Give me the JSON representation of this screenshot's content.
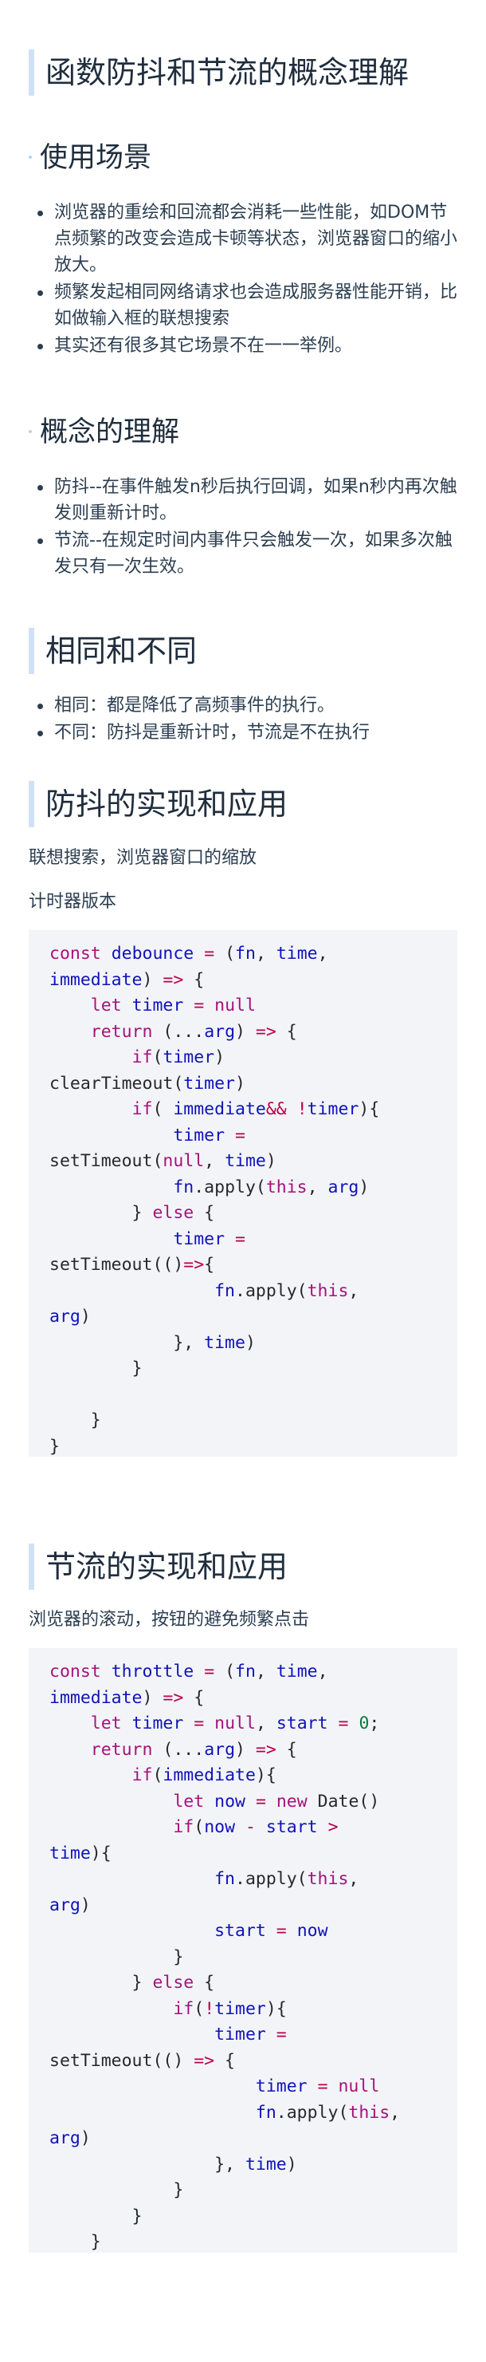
{
  "title": "函数防抖和节流的概念理解",
  "sections": {
    "scenarios": {
      "heading": "使用场景",
      "items": [
        "浏览器的重绘和回流都会消耗一些性能，如DOM节点频繁的改变会造成卡顿等状态，浏览器窗口的缩小放大。",
        "频繁发起相同网络请求也会造成服务器性能开销，比如做输入框的联想搜索",
        "其实还有很多其它场景不在一一举例。"
      ]
    },
    "concepts": {
      "heading": "概念的理解",
      "items": [
        "防抖--在事件触发n秒后执行回调，如果n秒内再次触发则重新计时。",
        "节流--在规定时间内事件只会触发一次，如果多次触发只有一次生效。"
      ]
    },
    "compare": {
      "heading": "相同和不同",
      "items": [
        "相同：都是降低了高频事件的执行。",
        "不同：防抖是重新计时，节流是不在执行"
      ]
    },
    "debounce": {
      "heading": "防抖的实现和应用",
      "para1": "联想搜索，浏览器窗口的缩放",
      "para2": "计时器版本",
      "code": "const debounce = (fn, time, immediate) => {\n    let timer = null\n    return (...arg) => {\n        if(timer) clearTimeout(timer)\n        if( immediate&& !timer){\n            timer = setTimeout(null, time)\n            fn.apply(this, arg)\n        } else {\n            timer = setTimeout(()=>{\n                fn.apply(this, arg)\n            }, time)\n        }\n\n    }\n}"
    },
    "throttle": {
      "heading": "节流的实现和应用",
      "para1": "浏览器的滚动，按钮的避免频繁点击",
      "code": "const throttle = (fn, time, immediate) => {\n    let timer = null, start = 0;\n    return (...arg) => {\n        if(immediate){\n            let now = new Date()\n            if(now - start > time){\n                fn.apply(this, arg)\n                start = now\n            }\n        } else {\n            if(!timer){\n                timer = setTimeout(() => {\n                    timer = null\n                    fn.apply(this, arg)\n                }, time)\n            }\n        }\n    }\n}"
    }
  },
  "colors": {
    "heading_bar": "#cfe1f7",
    "code_bg": "#f3f4f8",
    "keyword": "#a6127a",
    "identifier": "#0f13b8",
    "operator": "#b8004b"
  }
}
